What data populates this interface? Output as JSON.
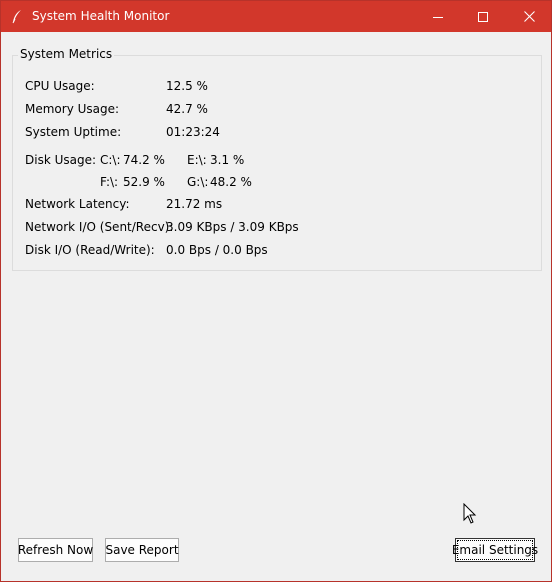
{
  "window": {
    "title": "System Health Monitor",
    "accent_color": "#d2372b",
    "controls": {
      "minimize": "minimize-icon",
      "maximize": "maximize-icon",
      "close": "close-icon"
    }
  },
  "metrics_group": {
    "title": "System Metrics",
    "cpu": {
      "label": "CPU Usage:",
      "value": "12.5 %"
    },
    "memory": {
      "label": "Memory Usage:",
      "value": "42.7 %"
    },
    "uptime": {
      "label": "System Uptime:",
      "value": "01:23:24"
    },
    "disk": {
      "label": "Disk Usage:",
      "drives": [
        {
          "drive": "C:\\:",
          "value": "74.2 %"
        },
        {
          "drive": "E:\\:",
          "value": "3.1 %"
        },
        {
          "drive": "F:\\:",
          "value": "52.9 %"
        },
        {
          "drive": "G:\\:",
          "value": "48.2 %"
        }
      ]
    },
    "latency": {
      "label": "Network Latency:",
      "value": "21.72 ms"
    },
    "net_io": {
      "label": "Network I/O (Sent/Recv):",
      "value": "3.09 KBps / 3.09 KBps"
    },
    "disk_io": {
      "label": "Disk I/O (Read/Write):",
      "value": "0.0 Bps / 0.0 Bps"
    }
  },
  "buttons": {
    "refresh": "Refresh Now",
    "save": "Save Report",
    "email": "Email Settings"
  }
}
